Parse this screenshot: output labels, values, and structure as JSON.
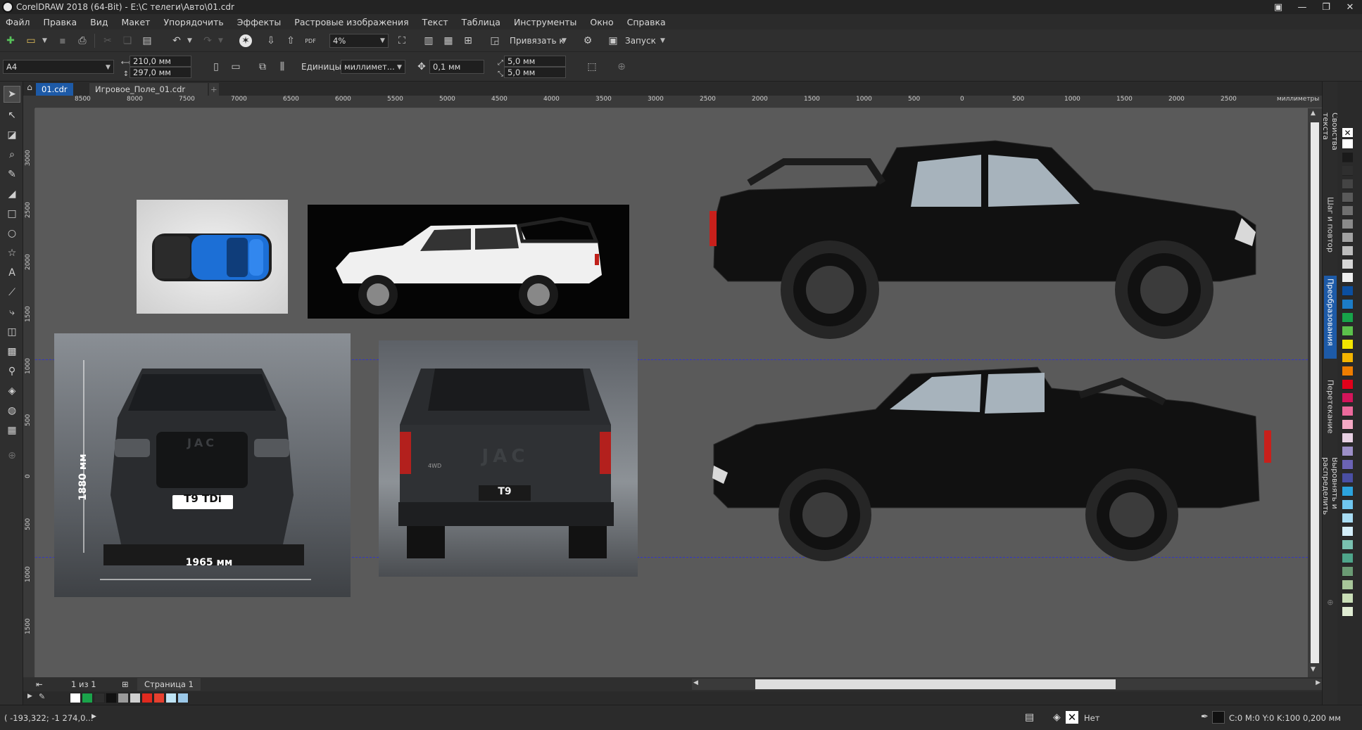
{
  "window": {
    "title": "CorelDRAW 2018 (64-Bit) - E:\\С телеги\\Авто\\01.cdr"
  },
  "menu": [
    "Файл",
    "Правка",
    "Вид",
    "Макет",
    "Упорядочить",
    "Эффекты",
    "Растровые изображения",
    "Текст",
    "Таблица",
    "Инструменты",
    "Окно",
    "Справка"
  ],
  "toolbar": {
    "zoom": "4%",
    "snap_label": "Привязать к",
    "launch_label": "Запуск",
    "pdf_label": "PDF"
  },
  "propbar": {
    "page_size": "A4",
    "width": "210,0 мм",
    "height": "297,0 мм",
    "units_label": "Единицы:",
    "units_value": "миллимет...",
    "nudge": "0,1 мм",
    "dup_x": "5,0 мм",
    "dup_y": "5,0 мм"
  },
  "tabs": [
    {
      "label": "01.cdr",
      "active": true
    },
    {
      "label": "Игровое_Поле_01.cdr",
      "active": false
    }
  ],
  "hruler": {
    "ticks": [
      "8500",
      "8000",
      "7500",
      "7000",
      "6500",
      "6000",
      "5500",
      "5000",
      "4500",
      "4000",
      "3500",
      "3000",
      "2500",
      "2000",
      "1500",
      "1000",
      "500",
      "0",
      "500",
      "1000",
      "1500",
      "2000",
      "2500"
    ],
    "unit": "миллиметры"
  },
  "vruler": {
    "ticks": [
      "3000",
      "2500",
      "2000",
      "1500",
      "1000",
      "500",
      "0",
      "500",
      "1000",
      "1500"
    ]
  },
  "canvas": {
    "front_plate": "T9 TDi",
    "rear_plate": "T9",
    "height_dim": "1880 мм",
    "width_dim": "1965 мм",
    "grille_text": "JAC",
    "rear_text": "JAC",
    "rear_badge": "4WD",
    "bed_text": "JAC"
  },
  "pagenav": {
    "counter": "1 из 1",
    "page_tab": "Страница 1"
  },
  "statusbar": {
    "coords": "( -193,322; -1 274,0... ",
    "fill_label": "Нет",
    "outline": "C:0 M:0 Y:0 K:100  0,200 мм"
  },
  "dockers": [
    "Свойства текста",
    "Шаг и повтор",
    "Преобразования",
    "Перетекание",
    "Выровнять и распределить"
  ],
  "bottom_swatches": [
    "#ffffff",
    "#1aa34a",
    "#2e2e2e",
    "#111111",
    "#9a9a9a",
    "#cfcfcf",
    "#e02a1f",
    "#e6402f",
    "#bfe4f5",
    "#9bc8e8"
  ],
  "palette": [
    "#ffffff",
    "#1a1a1a",
    "#2f2f2f",
    "#444444",
    "#5a5a5a",
    "#707070",
    "#8a8a8a",
    "#a2a2a2",
    "#bcbcbc",
    "#d6d6d6",
    "#eeeeee",
    "#0b4fa0",
    "#1c7cc7",
    "#17a44a",
    "#5cc14b",
    "#f3e500",
    "#f4b400",
    "#ef7d00",
    "#e2001a",
    "#d4145a",
    "#ec6a9c",
    "#f4a9c4",
    "#e8d1e3",
    "#9c8fc7",
    "#6b63b5",
    "#4a4fa3",
    "#2ca3dd",
    "#6fc6ef",
    "#a8dcf3",
    "#d4eef9",
    "#7ac1b0",
    "#4ea58a",
    "#6b9b74",
    "#a8c69a",
    "#c9deb7",
    "#e0ecd3"
  ]
}
